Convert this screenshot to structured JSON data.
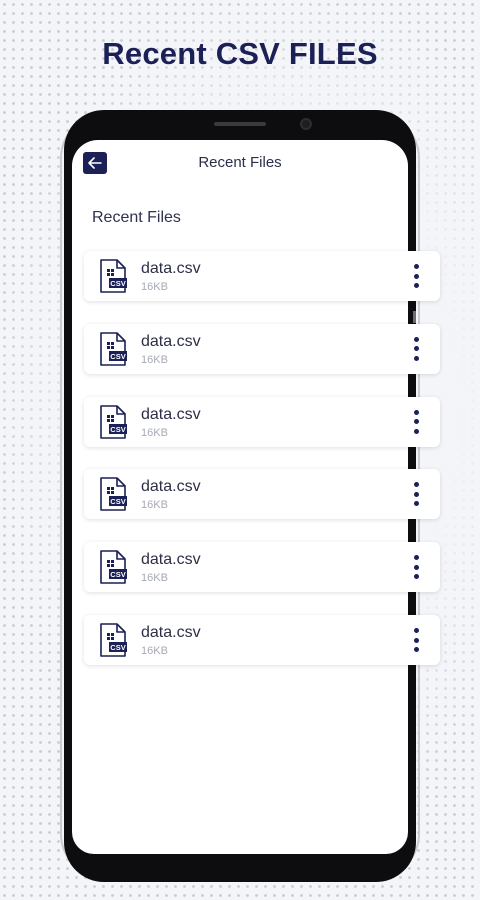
{
  "headline": {
    "prefix": "Recent",
    "emphasis": "CSV FILES"
  },
  "app": {
    "title": "Recent Files",
    "back_icon": "arrow-left-icon",
    "section_title": "Recent Files"
  },
  "files": [
    {
      "name": "data.csv",
      "size": "16KB",
      "icon": "csv-file-icon",
      "menu_icon": "more-vert-icon"
    },
    {
      "name": "data.csv",
      "size": "16KB",
      "icon": "csv-file-icon",
      "menu_icon": "more-vert-icon"
    },
    {
      "name": "data.csv",
      "size": "16KB",
      "icon": "csv-file-icon",
      "menu_icon": "more-vert-icon"
    },
    {
      "name": "data.csv",
      "size": "16KB",
      "icon": "csv-file-icon",
      "menu_icon": "more-vert-icon"
    },
    {
      "name": "data.csv",
      "size": "16KB",
      "icon": "csv-file-icon",
      "menu_icon": "more-vert-icon"
    },
    {
      "name": "data.csv",
      "size": "16KB",
      "icon": "csv-file-icon",
      "menu_icon": "more-vert-icon"
    }
  ],
  "file_icon_label": "CSV",
  "colors": {
    "brand": "#1b2056",
    "text": "#2c2f46",
    "muted": "#a7aab6"
  }
}
